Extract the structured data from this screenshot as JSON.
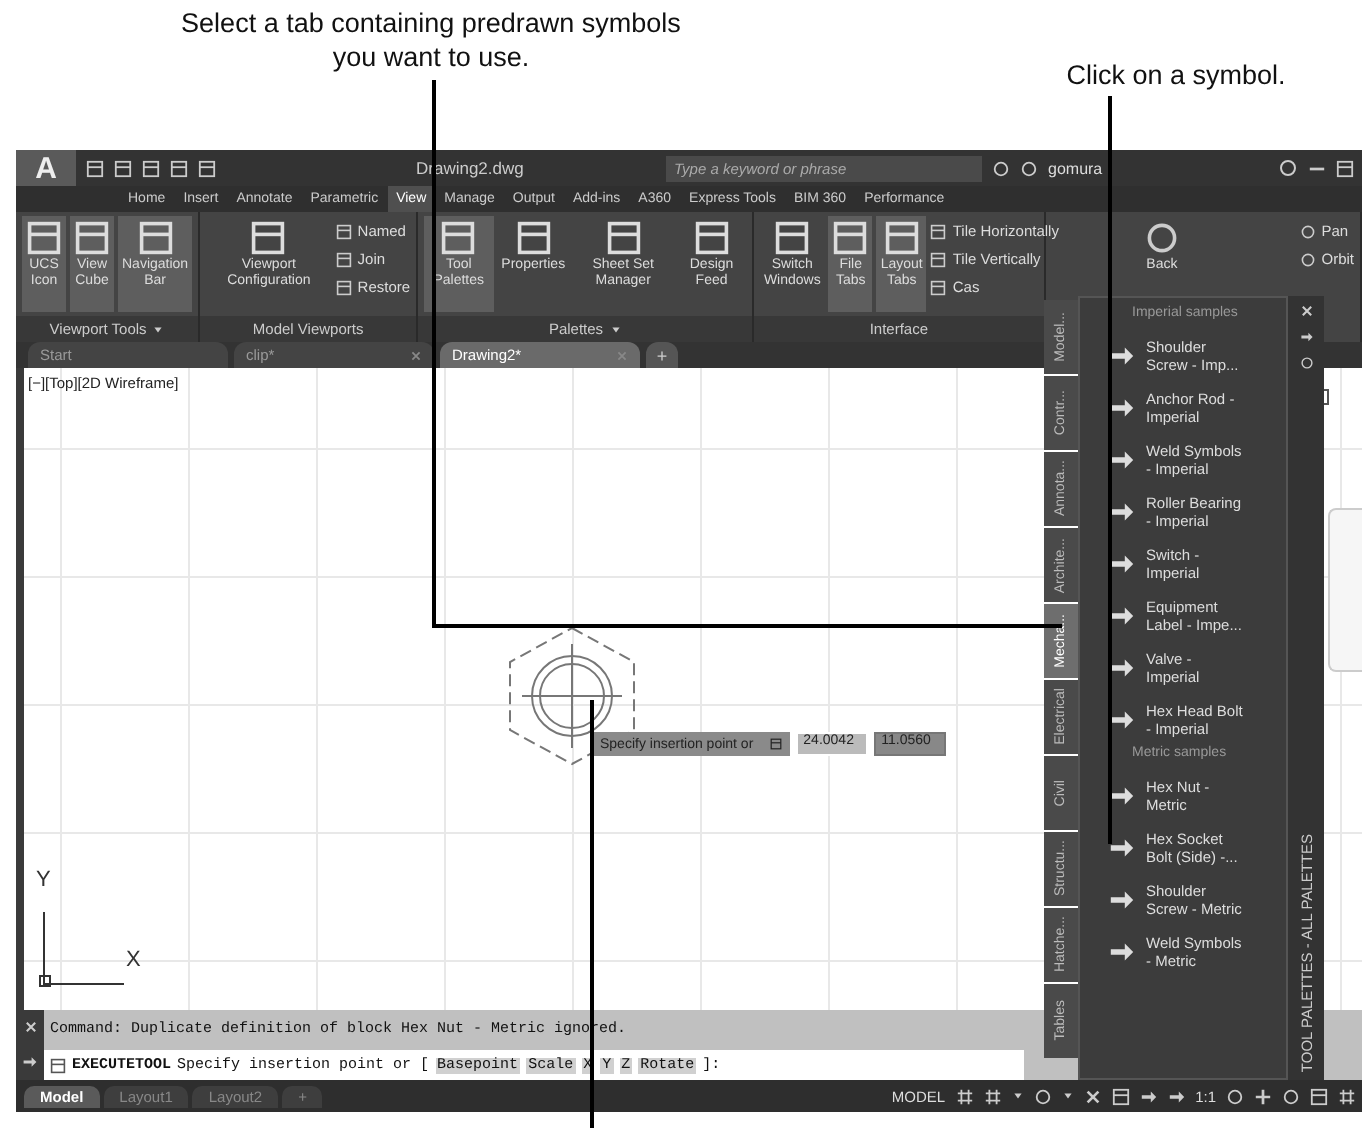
{
  "callouts": [
    {
      "text": "Select a tab containing predrawn symbols you want to use."
    },
    {
      "text": "Click on a symbol."
    }
  ],
  "title_bar": {
    "logo": "A",
    "file_name": "Drawing2.dwg",
    "search": {
      "placeholder": "Type a keyword or phrase"
    },
    "user": "gomura"
  },
  "ribbon_tabs": [
    {
      "label": "Home",
      "selected": false
    },
    {
      "label": "Insert",
      "selected": false
    },
    {
      "label": "Annotate",
      "selected": false
    },
    {
      "label": "Parametric",
      "selected": false
    },
    {
      "label": "View",
      "selected": true
    },
    {
      "label": "Manage",
      "selected": false
    },
    {
      "label": "Output",
      "selected": false
    },
    {
      "label": "Add-ins",
      "selected": false
    },
    {
      "label": "A360",
      "selected": false
    },
    {
      "label": "Express Tools",
      "selected": false
    },
    {
      "label": "BIM 360",
      "selected": false
    },
    {
      "label": "Performance",
      "selected": false
    }
  ],
  "ribbon_panels": [
    {
      "label": "Viewport Tools",
      "menu": true,
      "large": [
        {
          "label": "UCS Icon",
          "active": true
        },
        {
          "label": "View Cube",
          "active": true
        },
        {
          "label": "Navigation Bar",
          "active": true
        }
      ]
    },
    {
      "label": "Model Viewports",
      "menu": false,
      "large": [
        {
          "label": "Viewport Configuration",
          "active": false
        }
      ],
      "small": [
        {
          "label": "Named"
        },
        {
          "label": "Join"
        },
        {
          "label": "Restore"
        }
      ]
    },
    {
      "label": "Palettes",
      "menu": true,
      "large": [
        {
          "label": "Tool Palettes",
          "active": true
        },
        {
          "label": "Properties",
          "active": false
        },
        {
          "label": "Sheet Set Manager",
          "active": false
        },
        {
          "label": "Design Feed",
          "active": false
        }
      ]
    },
    {
      "label": "Interface",
      "menu": false,
      "large": [
        {
          "label": "Switch Windows",
          "active": false
        },
        {
          "label": "File Tabs",
          "active": true
        },
        {
          "label": "Layout Tabs",
          "active": true
        }
      ],
      "small": [
        {
          "label": "Tile Horizontally"
        },
        {
          "label": "Tile Vertically"
        },
        {
          "label": "Cas"
        }
      ]
    }
  ],
  "navigate": {
    "back": "Back",
    "pan": "Pan",
    "orbit": "Orbit"
  },
  "doc_tabs": [
    {
      "label": "Start",
      "selected": false,
      "closable": false
    },
    {
      "label": "clip*",
      "selected": false,
      "closable": true
    },
    {
      "label": "Drawing2*",
      "selected": true,
      "closable": true
    }
  ],
  "new_tab": "+",
  "viewport": {
    "label": "[−][Top][2D Wireframe]",
    "ucs_y": "Y",
    "ucs_x": "X",
    "tooltip": {
      "prompt": "Specify insertion point or",
      "x_value": "24.0042",
      "y_value": "11.0560"
    }
  },
  "tool_palette": {
    "title": "TOOL PALETTES - ALL PALETTES",
    "tabs": [
      {
        "label": "Model...",
        "selected": false
      },
      {
        "label": "Contr...",
        "selected": false
      },
      {
        "label": "Annota...",
        "selected": false
      },
      {
        "label": "Archite...",
        "selected": false
      },
      {
        "label": "Mecha...",
        "selected": true
      },
      {
        "label": "Electrical",
        "selected": false
      },
      {
        "label": "Civil",
        "selected": false
      },
      {
        "label": "Structu...",
        "selected": false
      },
      {
        "label": "Hatche...",
        "selected": false
      },
      {
        "label": "Tables",
        "selected": false
      }
    ],
    "sections": [
      {
        "heading": "Imperial samples",
        "items": [
          "Shoulder\nScrew - Imp...",
          "Anchor Rod -\nImperial",
          "Weld Symbols\n- Imperial",
          "Roller Bearing\n- Imperial",
          "Switch -\nImperial",
          "Equipment\nLabel - Impe...",
          "Valve -\nImperial",
          "Hex Head Bolt\n- Imperial"
        ]
      },
      {
        "heading": "Metric samples",
        "items": [
          "Hex Nut -\nMetric",
          "Hex Socket\nBolt (Side) -...",
          "Shoulder\nScrew - Metric",
          "Weld Symbols\n- Metric"
        ]
      }
    ]
  },
  "command_line": {
    "history": "Command:  Duplicate definition of block Hex Nut - Metric  ignored.",
    "command": "EXECUTETOOL",
    "prompt": "Specify insertion point or [",
    "options": [
      "Basepoint",
      "Scale",
      "X",
      "Y",
      "Z",
      "Rotate"
    ],
    "end": "]:"
  },
  "layout_tabs": [
    {
      "label": "Model",
      "selected": true
    },
    {
      "label": "Layout1",
      "selected": false
    },
    {
      "label": "Layout2",
      "selected": false
    }
  ],
  "new_layout": "+",
  "status_bar": {
    "mode": "MODEL",
    "scale": "1:1"
  }
}
